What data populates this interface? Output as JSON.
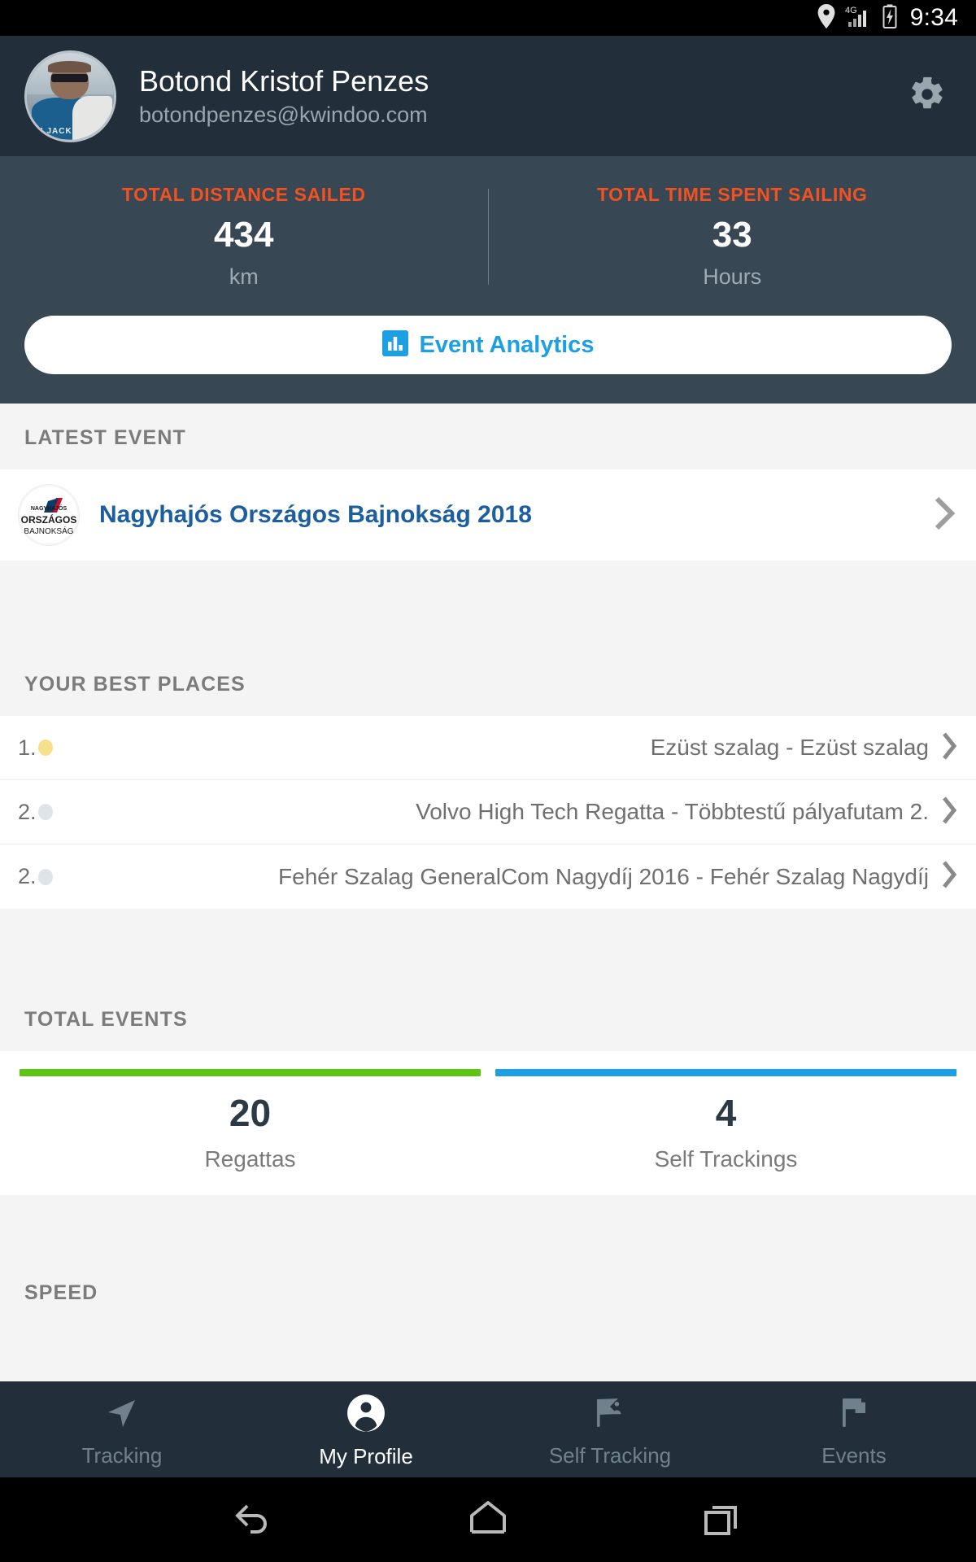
{
  "status_bar": {
    "time": "9:34",
    "icons": [
      "location-pin-icon",
      "signal-4g-icon",
      "battery-charging-icon"
    ],
    "network_label": "4G"
  },
  "profile": {
    "name": "Botond Kristof Penzes",
    "email": "botondpenzes@kwindoo.com",
    "avatar_alt": "user-avatar",
    "settings_icon": "gear-icon",
    "avatar_vest_text": "CH JACK"
  },
  "stats": {
    "distance": {
      "label": "TOTAL DISTANCE SAILED",
      "value": "434",
      "unit": "km"
    },
    "time": {
      "label": "TOTAL TIME SPENT SAILING",
      "value": "33",
      "unit": "Hours"
    },
    "accent_color": "#f4511e",
    "panel_color": "#374753"
  },
  "analytics_button": {
    "label": "Event Analytics",
    "icon": "bar-chart-icon",
    "color": "#1ca0e3"
  },
  "latest_event": {
    "section_title": "LATEST EVENT",
    "title": "Nagyhajós Országos Bajnokság 2018",
    "logo_lines": [
      "NAGYHAJÓS",
      "ORSZÁGOS",
      "BAJNOKSÁG"
    ],
    "title_color": "#1c5e9e"
  },
  "best_places": {
    "section_title": "YOUR BEST PLACES",
    "rows": [
      {
        "rank": "1.",
        "medal": "gold",
        "medal_color": "#f6e08a",
        "name": "Ezüst szalag - Ezüst szalag"
      },
      {
        "rank": "2.",
        "medal": "silver",
        "medal_color": "#dfe4e8",
        "name": "Volvo High Tech Regatta - Többtestű pályafutam 2."
      },
      {
        "rank": "2.",
        "medal": "silver",
        "medal_color": "#dfe4e8",
        "name": "Fehér Szalag GeneralCom Nagydíj 2016 - Fehér Szalag Nagydíj"
      }
    ]
  },
  "total_events": {
    "section_title": "TOTAL EVENTS",
    "columns": [
      {
        "value": "20",
        "label": "Regattas",
        "bar_color": "#5cc413"
      },
      {
        "value": "4",
        "label": "Self Trackings",
        "bar_color": "#1ca0e3"
      }
    ]
  },
  "speed": {
    "section_title": "SPEED"
  },
  "bottom_nav": {
    "items": [
      {
        "label": "Tracking",
        "icon": "navigation-arrow-icon",
        "active": false
      },
      {
        "label": "My Profile",
        "icon": "person-circle-icon",
        "active": true
      },
      {
        "label": "Self Tracking",
        "icon": "flag-person-icon",
        "active": false
      },
      {
        "label": "Events",
        "icon": "flag-icon",
        "active": false
      }
    ]
  },
  "system_nav": {
    "buttons": [
      {
        "name": "back-icon"
      },
      {
        "name": "home-icon"
      },
      {
        "name": "recents-icon"
      }
    ]
  }
}
